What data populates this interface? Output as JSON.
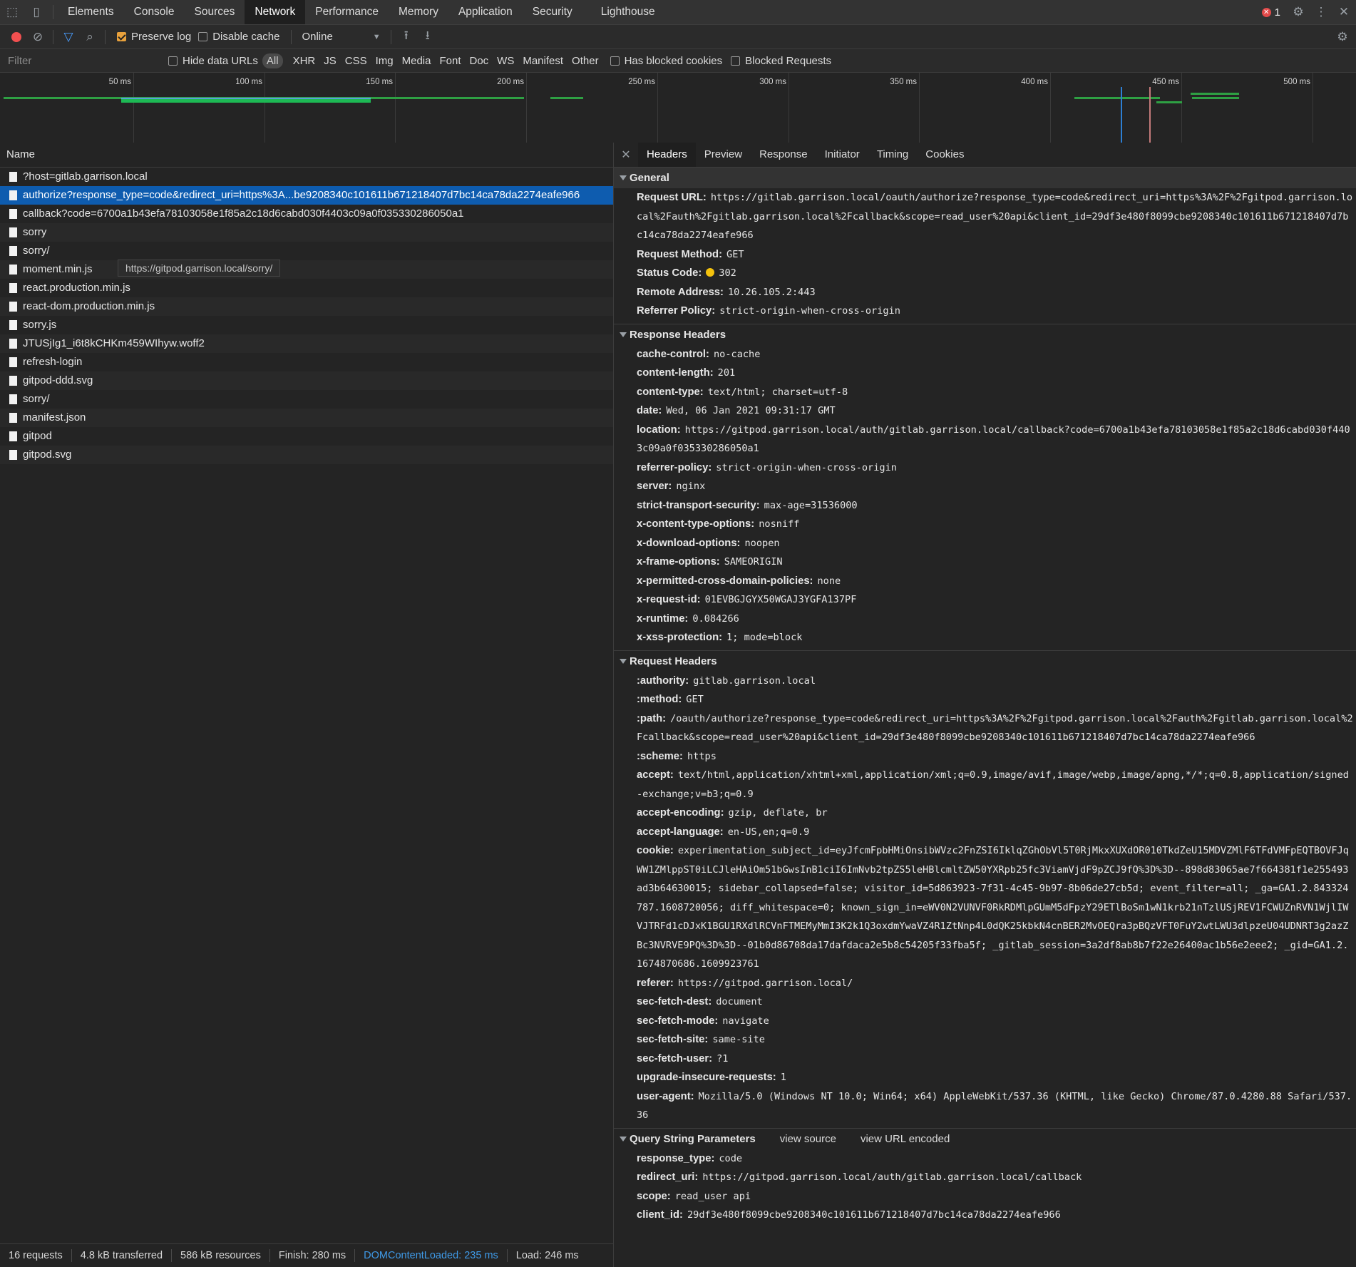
{
  "top_tabs": [
    "Elements",
    "Console",
    "Sources",
    "Network",
    "Performance",
    "Memory",
    "Application",
    "Security",
    "Lighthouse"
  ],
  "active_tab": "Network",
  "error_count": "1",
  "toolbar": {
    "preserve_log": "Preserve log",
    "disable_cache": "Disable cache",
    "throttle": "Online"
  },
  "filter_bar": {
    "placeholder": "Filter",
    "hide_data_urls": "Hide data URLs",
    "types": [
      "All",
      "XHR",
      "JS",
      "CSS",
      "Img",
      "Media",
      "Font",
      "Doc",
      "WS",
      "Manifest",
      "Other"
    ],
    "has_blocked_cookies": "Has blocked cookies",
    "blocked_requests": "Blocked Requests"
  },
  "overview": {
    "ticks": [
      "50 ms",
      "100 ms",
      "150 ms",
      "200 ms",
      "250 ms",
      "300 ms",
      "350 ms",
      "400 ms",
      "450 ms",
      "500 ms"
    ]
  },
  "requests": {
    "header": "Name",
    "items": [
      "?host=gitlab.garrison.local",
      "authorize?response_type=code&redirect_uri=https%3A...be9208340c101611b671218407d7bc14ca78da2274eafe966",
      "callback?code=6700a1b43efa78103058e1f85a2c18d6cabd030f4403c09a0f035330286050a1",
      "sorry",
      "sorry/",
      "moment.min.js",
      "react.production.min.js",
      "react-dom.production.min.js",
      "sorry.js",
      "JTUSjIg1_i6t8kCHKm459WIhyw.woff2",
      "refresh-login",
      "gitpod-ddd.svg",
      "sorry/",
      "manifest.json",
      "gitpod",
      "gitpod.svg"
    ],
    "selected_index": 1,
    "tooltip": "https://gitpod.garrison.local/sorry/"
  },
  "status_bar": {
    "requests": "16 requests",
    "transferred": "4.8 kB transferred",
    "resources": "586 kB resources",
    "finish": "Finish: 280 ms",
    "dom_loaded": "DOMContentLoaded: 235 ms",
    "load": "Load: 246 ms"
  },
  "detail_tabs": [
    "Headers",
    "Preview",
    "Response",
    "Initiator",
    "Timing",
    "Cookies"
  ],
  "detail_active": "Headers",
  "general": {
    "title": "General",
    "rows": [
      {
        "k": "Request URL:",
        "v": "https://gitlab.garrison.local/oauth/authorize?response_type=code&redirect_uri=https%3A%2F%2Fgitpod.garrison.local%2Fauth%2Fgitlab.garrison.local%2Fcallback&scope=read_user%20api&client_id=29df3e480f8099cbe9208340c101611b671218407d7bc14ca78da2274eafe966"
      },
      {
        "k": "Request Method:",
        "v": "GET"
      },
      {
        "k": "Status Code:",
        "v": "302",
        "status_color": "#f4c20d"
      },
      {
        "k": "Remote Address:",
        "v": "10.26.105.2:443"
      },
      {
        "k": "Referrer Policy:",
        "v": "strict-origin-when-cross-origin"
      }
    ]
  },
  "response_headers": {
    "title": "Response Headers",
    "rows": [
      {
        "k": "cache-control:",
        "v": "no-cache"
      },
      {
        "k": "content-length:",
        "v": "201"
      },
      {
        "k": "content-type:",
        "v": "text/html; charset=utf-8"
      },
      {
        "k": "date:",
        "v": "Wed, 06 Jan 2021 09:31:17 GMT"
      },
      {
        "k": "location:",
        "v": "https://gitpod.garrison.local/auth/gitlab.garrison.local/callback?code=6700a1b43efa78103058e1f85a2c18d6cabd030f4403c09a0f035330286050a1"
      },
      {
        "k": "referrer-policy:",
        "v": "strict-origin-when-cross-origin"
      },
      {
        "k": "server:",
        "v": "nginx"
      },
      {
        "k": "strict-transport-security:",
        "v": "max-age=31536000"
      },
      {
        "k": "x-content-type-options:",
        "v": "nosniff"
      },
      {
        "k": "x-download-options:",
        "v": "noopen"
      },
      {
        "k": "x-frame-options:",
        "v": "SAMEORIGIN"
      },
      {
        "k": "x-permitted-cross-domain-policies:",
        "v": "none"
      },
      {
        "k": "x-request-id:",
        "v": "01EVBGJGYX50WGAJ3YGFA137PF"
      },
      {
        "k": "x-runtime:",
        "v": "0.084266"
      },
      {
        "k": "x-xss-protection:",
        "v": "1; mode=block"
      }
    ]
  },
  "request_headers": {
    "title": "Request Headers",
    "rows": [
      {
        "k": ":authority:",
        "v": "gitlab.garrison.local"
      },
      {
        "k": ":method:",
        "v": "GET"
      },
      {
        "k": ":path:",
        "v": "/oauth/authorize?response_type=code&redirect_uri=https%3A%2F%2Fgitpod.garrison.local%2Fauth%2Fgitlab.garrison.local%2Fcallback&scope=read_user%20api&client_id=29df3e480f8099cbe9208340c101611b671218407d7bc14ca78da2274eafe966"
      },
      {
        "k": ":scheme:",
        "v": "https"
      },
      {
        "k": "accept:",
        "v": "text/html,application/xhtml+xml,application/xml;q=0.9,image/avif,image/webp,image/apng,*/*;q=0.8,application/signed-exchange;v=b3;q=0.9"
      },
      {
        "k": "accept-encoding:",
        "v": "gzip, deflate, br"
      },
      {
        "k": "accept-language:",
        "v": "en-US,en;q=0.9"
      },
      {
        "k": "cookie:",
        "v": "experimentation_subject_id=eyJfcmFpbHMiOnsibWVzc2FnZSI6IklqZGhObVl5T0RjMkxXUXdOR010TkdZeU15MDVZMlF6TFdVMFpEQTBOVFJqWW1ZMlppST0iLCJleHAiOm51bGwsInB1ciI6ImNvb2tpZS5leHBlcmltZW50YXRpb25fc3ViamVjdF9pZCJ9fQ%3D%3D--898d83065ae7f664381f1e255493ad3b64630015; sidebar_collapsed=false; visitor_id=5d863923-7f31-4c45-9b97-8b06de27cb5d; event_filter=all; _ga=GA1.2.843324787.1608720056; diff_whitespace=0; known_sign_in=eWV0N2VUNVF0RkRDMlpGUmM5dFpzY29ETlBoSm1wN1krb21nTzlUSjREV1FCWUZnRVN1WjlIWVJTRFd1cDJxK1BGU1RXdlRCVnFTMEMyMmI3K2k1Q3oxdmYwaVZ4R1ZtNnp4L0dQK25kbkN4cnBER2MvOEQra3pBQzVFT0FuY2wtLWU3dlpzeU04UDNRT3g2azZBc3NVRVE9PQ%3D%3D--01b0d86708da17dafdaca2e5b8c54205f33fba5f; _gitlab_session=3a2df8ab8b7f22e26400ac1b56e2eee2; _gid=GA1.2.1674870686.1609923761"
      },
      {
        "k": "referer:",
        "v": "https://gitpod.garrison.local/"
      },
      {
        "k": "sec-fetch-dest:",
        "v": "document"
      },
      {
        "k": "sec-fetch-mode:",
        "v": "navigate"
      },
      {
        "k": "sec-fetch-site:",
        "v": "same-site"
      },
      {
        "k": "sec-fetch-user:",
        "v": "?1"
      },
      {
        "k": "upgrade-insecure-requests:",
        "v": "1"
      },
      {
        "k": "user-agent:",
        "v": "Mozilla/5.0 (Windows NT 10.0; Win64; x64) AppleWebKit/537.36 (KHTML, like Gecko) Chrome/87.0.4280.88 Safari/537.36"
      }
    ]
  },
  "query_params": {
    "title": "Query String Parameters",
    "view_source": "view source",
    "view_url_encoded": "view URL encoded",
    "rows": [
      {
        "k": "response_type:",
        "v": "code"
      },
      {
        "k": "redirect_uri:",
        "v": "https://gitpod.garrison.local/auth/gitlab.garrison.local/callback"
      },
      {
        "k": "scope:",
        "v": "read_user api"
      },
      {
        "k": "client_id:",
        "v": "29df3e480f8099cbe9208340c101611b671218407d7bc14ca78da2274eafe966"
      }
    ]
  }
}
